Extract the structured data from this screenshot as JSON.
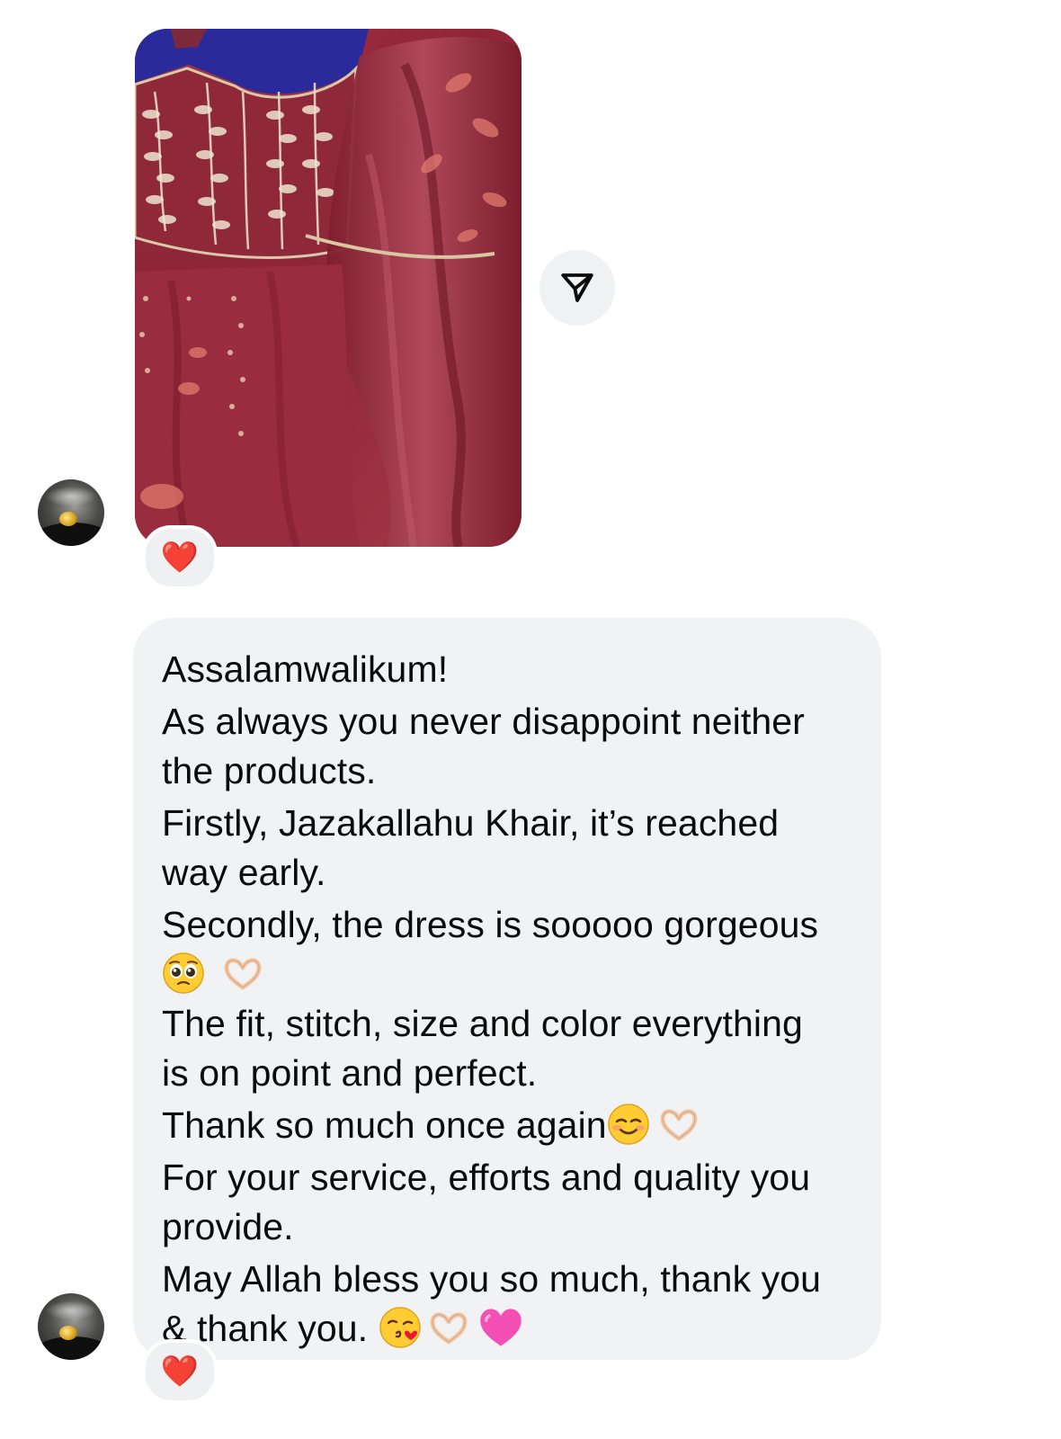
{
  "chat": {
    "image_message": {
      "reaction": "❤️"
    },
    "text_message": {
      "lines": [
        "Assalamwalikum!",
        "As always you never disappoint neither",
        "the products.",
        "Firstly, Jazakallahu Khair, it’s reached",
        "way early.",
        "Secondly, the dress is sooooo gorgeous",
        "The fit, stitch, size and color everything",
        "is on point and perfect.",
        "Thank so much once again",
        "For your service, efforts and quality you",
        "provide.",
        "May Allah bless you so much, thank you",
        "& thank you. "
      ],
      "emojis": {
        "line7": [
          "pleading-face",
          "heart-hands"
        ],
        "line9": [
          "smiling-face",
          "heart-hands"
        ],
        "line13": [
          "face-blowing-kiss",
          "heart-hands",
          "pink-heart"
        ]
      },
      "reaction": "❤️"
    }
  },
  "colors": {
    "bubble_bg": "#f1f2f4",
    "reaction_heart": "#e8192c",
    "dress": "#9b2b3a"
  }
}
